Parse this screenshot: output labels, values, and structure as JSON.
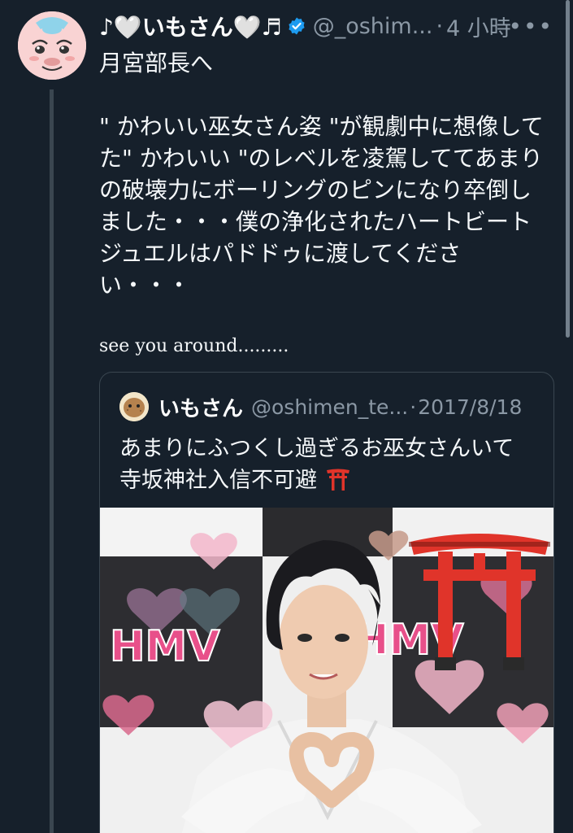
{
  "tweet": {
    "display_name": "♪🤍いもさん🤍♬",
    "handle": "@_oshim...",
    "separator": "·",
    "time": "4 小時",
    "more": "•••",
    "lines": [
      "月宮部長へ",
      "\" かわいい巫女さん姿 \"が観劇中に想像して",
      "た\" かわいい \"のレベルを凌駕しててあまり",
      "の破壊力にボーリングのピンになり卒倒し",
      "ました・・・僕の浄化されたハートビート",
      "ジュエルはパドドゥに渡してくださ",
      "い・・・"
    ],
    "signoff": "see you around........."
  },
  "quote": {
    "display_name": "いもさん",
    "handle": "@oshimen_te...",
    "separator": "·",
    "date": "2017/8/18",
    "lines": [
      "あまりにふつくし過ぎるお巫女さんいて",
      "寺坂神社入信不可避"
    ],
    "image": {
      "banner_text_left": "HMV",
      "banner_text_right": "HMV"
    }
  },
  "colors": {
    "background": "#16202b",
    "text": "#f5f8fa",
    "secondary": "#8b98a5",
    "verified": "#1d9bf0",
    "torii": "#e0342a"
  }
}
